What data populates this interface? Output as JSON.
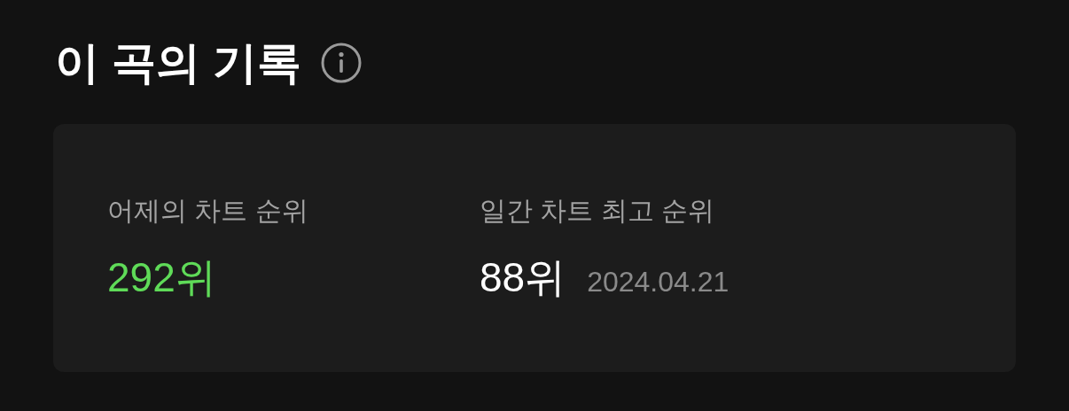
{
  "title": "이 곡의 기록",
  "stats": [
    {
      "label": "어제의 차트 순위",
      "value": "292위",
      "highlighted": true
    },
    {
      "label": "일간 차트 최고 순위",
      "value": "88위",
      "highlighted": false,
      "date": "2024.04.21"
    }
  ]
}
